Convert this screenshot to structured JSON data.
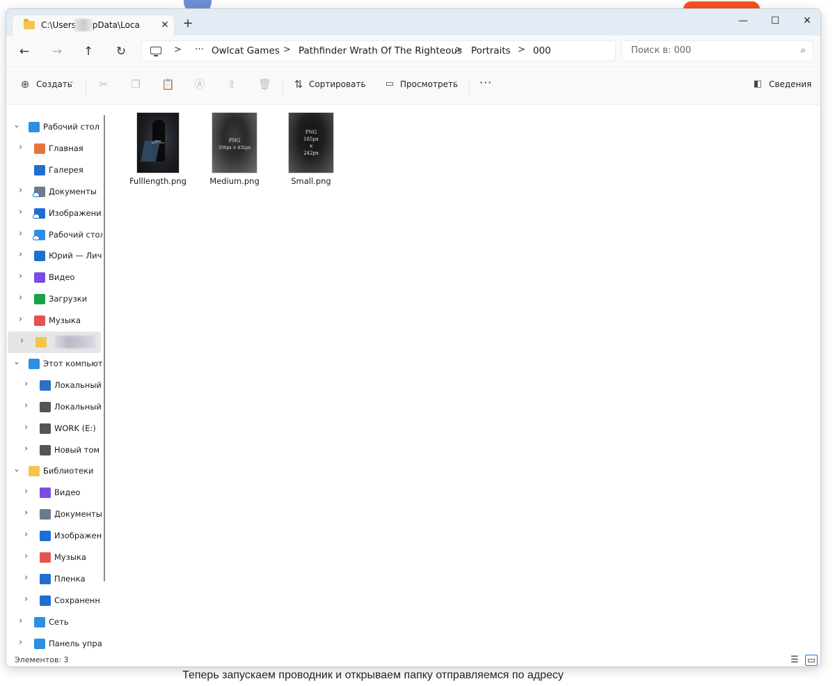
{
  "window": {
    "tab_title": "C:\\Users\\      AppData\\Loca",
    "tab_close": "✕",
    "new_tab": "+",
    "minimize": "—",
    "maximize": "☐",
    "close": "✕"
  },
  "nav": {
    "back": "←",
    "forward": "→",
    "up": "↑",
    "refresh": "↻",
    "more_crumbs": "···",
    "breadcrumbs": [
      "Owlcat Games",
      "Pathfinder Wrath Of The Righteous",
      "Portraits",
      "000"
    ],
    "separator": ">",
    "search_placeholder": "Поиск в: 000",
    "search_icon": "⌕"
  },
  "toolbar": {
    "create": "Создать",
    "sort": "Сортировать",
    "view": "Просмотреть",
    "more": "···",
    "details": "Сведения",
    "icons": [
      "cut-icon",
      "copy-icon",
      "paste-icon",
      "rename-icon",
      "share-icon",
      "delete-icon"
    ]
  },
  "sidebar": {
    "items": [
      {
        "label": "Рабочий стол",
        "icon": "desktop-icon",
        "color": "#2c8fe3"
      },
      {
        "label": "Главная",
        "icon": "home-icon",
        "color": "#e8733a"
      },
      {
        "label": "Галерея",
        "icon": "gallery-icon",
        "color": "#1f6fd1"
      },
      {
        "label": "Документы",
        "icon": "documents-icon",
        "color": "#6b7b8c"
      },
      {
        "label": "Изображения",
        "icon": "pictures-icon",
        "color": "#1f6fd1"
      },
      {
        "label": "Рабочий стол",
        "icon": "desktop-icon",
        "color": "#2c8fe3"
      },
      {
        "label": "Юрий — Личн",
        "icon": "onedrive-icon",
        "color": "#1f6fd1"
      },
      {
        "label": "Видео",
        "icon": "video-icon",
        "color": "#7a4de0"
      },
      {
        "label": "Загрузки",
        "icon": "downloads-icon",
        "color": "#16a34a"
      },
      {
        "label": "Музыка",
        "icon": "music-icon",
        "color": "#e2554f"
      },
      {
        "label": "",
        "icon": "folder-icon",
        "color": "#f6c44a"
      },
      {
        "label": "Этот компьют",
        "icon": "this-pc-icon",
        "color": "#2c8fe3"
      },
      {
        "label": "Локальный д",
        "icon": "drive-windows-icon",
        "color": "#2c6fc4"
      },
      {
        "label": "Локальный д",
        "icon": "drive-icon",
        "color": "#555555"
      },
      {
        "label": "WORK (E:)",
        "icon": "drive-icon",
        "color": "#555555"
      },
      {
        "label": "Новый том (",
        "icon": "drive-icon",
        "color": "#555555"
      },
      {
        "label": "Библиотеки",
        "icon": "libraries-icon",
        "color": "#f6c44a"
      },
      {
        "label": "Видео",
        "icon": "video-icon",
        "color": "#7a4de0"
      },
      {
        "label": "Документы",
        "icon": "documents-icon",
        "color": "#6b7b8c"
      },
      {
        "label": "Изображени",
        "icon": "pictures-icon",
        "color": "#1f6fd1"
      },
      {
        "label": "Музыка",
        "icon": "music-icon",
        "color": "#e2554f"
      },
      {
        "label": "Пленка",
        "icon": "pictures-icon",
        "color": "#1f6fd1"
      },
      {
        "label": "Сохраненн",
        "icon": "pictures-icon",
        "color": "#1f6fd1"
      },
      {
        "label": "Сеть",
        "icon": "network-icon",
        "color": "#2c8fe3"
      },
      {
        "label": "Панель управ",
        "icon": "control-panel-icon",
        "color": "#2c8fe3"
      }
    ]
  },
  "files": [
    {
      "name": "Fulllength.png",
      "thumb_lines": [
        "PNG",
        "692 × 1024"
      ]
    },
    {
      "name": "Medium.png",
      "thumb_lines": [
        "PNG",
        "330px × 432px"
      ]
    },
    {
      "name": "Small.png",
      "thumb_lines": [
        "PNG",
        "185px",
        "×",
        "242px"
      ]
    }
  ],
  "status": {
    "count": "Элементов: 3",
    "list_view_icon": "☰",
    "tiles_view_icon": "▭"
  },
  "caption": "Теперь запускаем проводник и открываем папку отправляемся по адресу"
}
